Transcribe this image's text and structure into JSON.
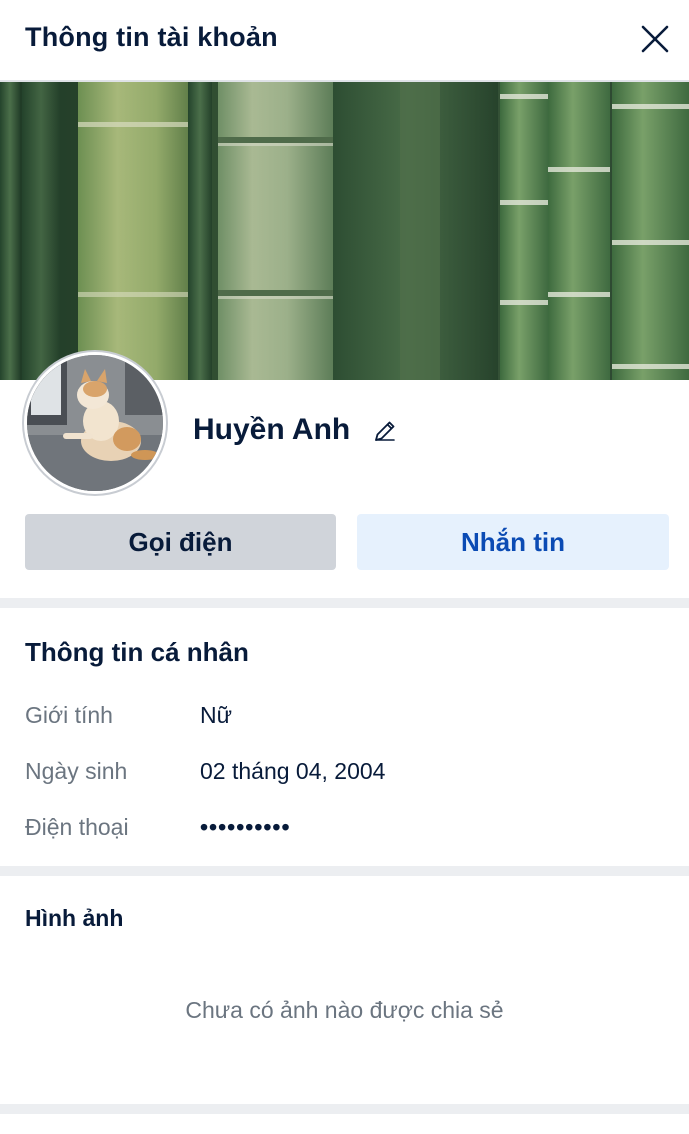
{
  "header": {
    "title": "Thông tin tài khoản",
    "close_icon": "close-icon"
  },
  "profile": {
    "name": "Huyền Anh",
    "edit_icon": "pencil-icon",
    "cover_image": "bamboo-forest",
    "avatar_image": "cat-photo"
  },
  "actions": {
    "call_label": "Gọi điện",
    "message_label": "Nhắn tin"
  },
  "personal_info": {
    "title": "Thông tin cá nhân",
    "rows": [
      {
        "label": "Giới tính",
        "value": "Nữ"
      },
      {
        "label": "Ngày sinh",
        "value": "02 tháng 04, 2004"
      },
      {
        "label": "Điện thoại",
        "value": "••••••••••"
      }
    ]
  },
  "photos": {
    "title": "Hình ảnh",
    "empty_text": "Chưa có ảnh nào được chia sẻ"
  },
  "colors": {
    "text_primary": "#081b3a",
    "text_secondary": "#6b7580",
    "accent": "#0b4bb4",
    "accent_bg": "#e6f1fd",
    "neutral_button": "#d0d4da",
    "separator": "#eceef1"
  }
}
